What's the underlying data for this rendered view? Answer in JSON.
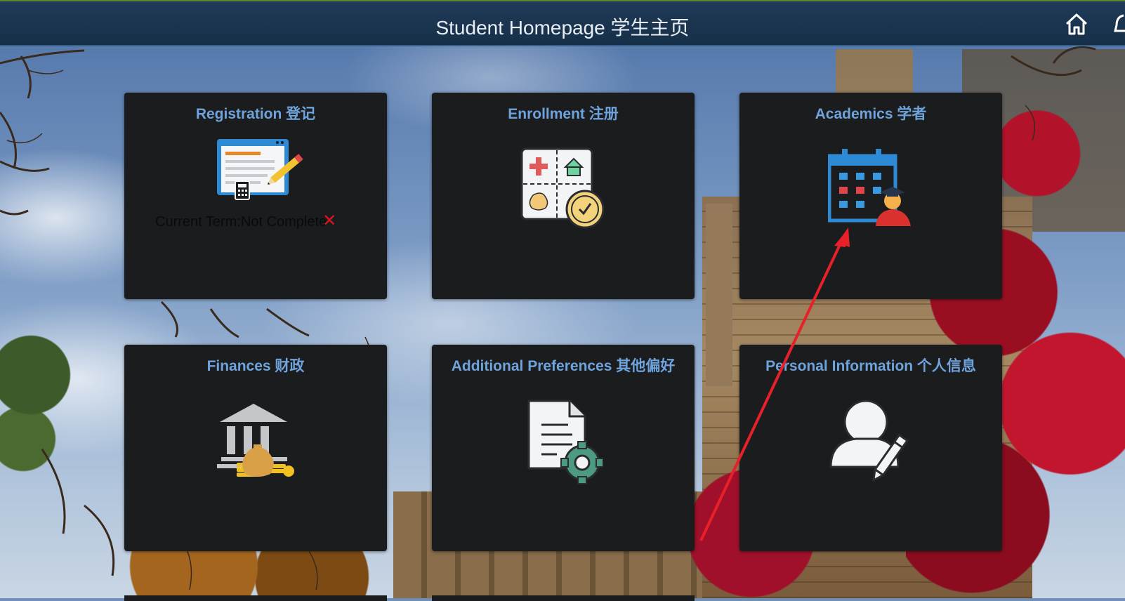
{
  "header": {
    "title": "Student Homepage 学生主页",
    "home_icon": "home-icon",
    "notification_icon": "bell-icon"
  },
  "tiles": [
    {
      "title": "Registration 登记",
      "icon": "registration-form-icon",
      "status_text": "Current Term:Not Complete",
      "status_icon": "red-x-icon"
    },
    {
      "title": "Enrollment 注册",
      "icon": "enrollment-board-icon"
    },
    {
      "title": "Academics 学者",
      "icon": "calendar-graduate-icon"
    },
    {
      "title": "Finances 财政",
      "icon": "bank-money-icon"
    },
    {
      "title": "Additional Preferences 其他偏好",
      "icon": "document-gear-icon"
    },
    {
      "title": "Personal Information 个人信息",
      "icon": "person-edit-icon"
    }
  ],
  "annotation": {
    "type": "red arrow",
    "color": "#e8202a"
  },
  "colors": {
    "header_bg": "#1f3a58",
    "tile_bg": "#1b1c1e",
    "tile_title": "#6fa3db",
    "status_error": "#e0141e"
  }
}
